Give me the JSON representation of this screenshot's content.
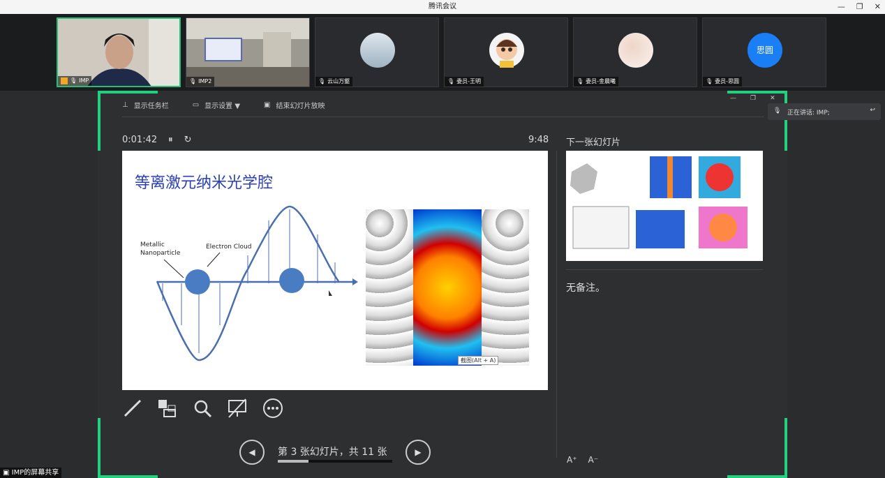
{
  "window": {
    "title": "腾讯会议"
  },
  "participants": [
    {
      "name": "IMP"
    },
    {
      "name": "IMP2"
    },
    {
      "name": "云山万壑"
    },
    {
      "name": "委员-王明"
    },
    {
      "name": "委员-金晨曦"
    },
    {
      "name": "委员-思圆",
      "avatar_text": "思圆"
    }
  ],
  "toolbar": {
    "taskbar": "显示任务栏",
    "display": "显示设置 ▼",
    "end": "结束幻灯片放映"
  },
  "timer": {
    "elapsed": "0:01:42",
    "clock": "9:48"
  },
  "slide": {
    "title": "等离激元纳米光学腔",
    "label_metallic": "Metallic",
    "label_nanoparticle": "Nanoparticle",
    "label_cloud": "Electron Cloud",
    "tooltip": "截图(Alt + A)"
  },
  "next": {
    "label": "下一张幻灯片",
    "notes": "无备注。"
  },
  "nav": {
    "counter": "第 3 张幻灯片，共 11 张",
    "progress": 0.27
  },
  "speaking": {
    "label": "正在讲话: IMP;"
  },
  "share": {
    "label": "IMP的屏幕共享"
  },
  "colors": {
    "accent": "#22d07f",
    "blue": "#1a7ef5",
    "slide_title": "#2a3fb8"
  }
}
